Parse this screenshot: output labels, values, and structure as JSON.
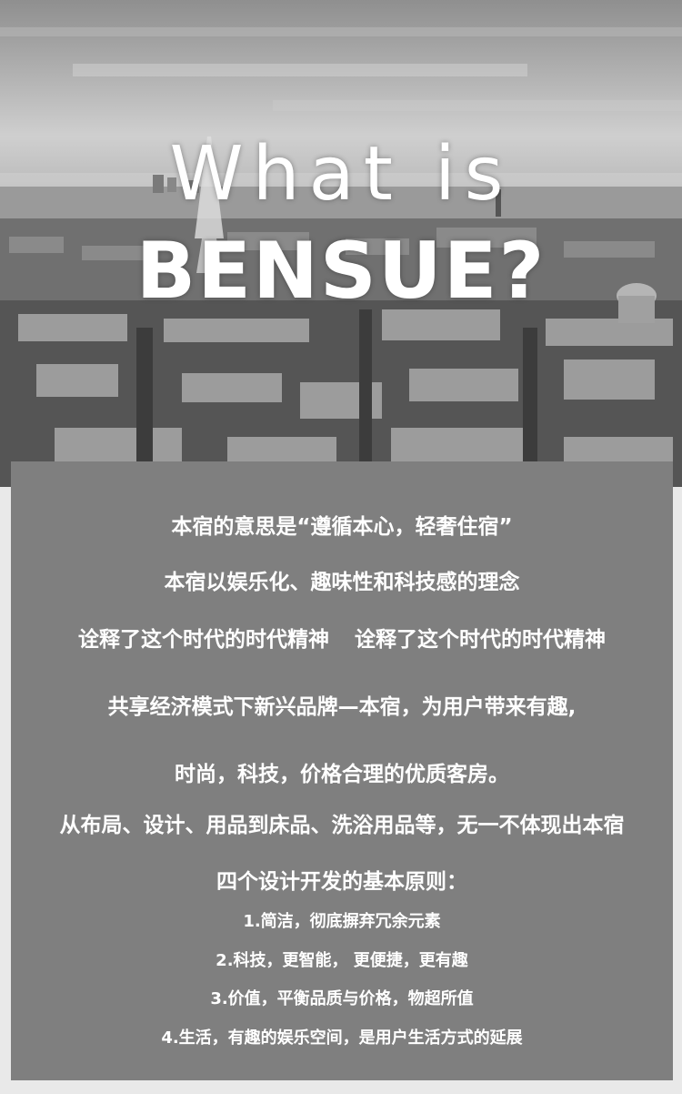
{
  "hero": {
    "title_line1": "What is",
    "title_line2": "BENSUE?"
  },
  "intro": {
    "line1": "本宿的意思是“遵循本心，轻奢住宿”",
    "line2": "本宿以娱乐化、趣味性和科技感的理念",
    "line3a": "诠释了这个时代的时代精神",
    "line3b": "诠释了这个时代的时代精神",
    "line4": "共享经济模式下新兴品牌—本宿，为用户带来有趣,",
    "line5": "时尚，科技，价格合理的优质客房。",
    "line6": "从布局、设计、用品到床品、洗浴用品等，无一不体现出本宿",
    "line7": "四个设计开发的基本原则："
  },
  "principles": [
    "1.简洁，彻底摒弃冗余元素",
    "2.科技，更智能， 更便捷，更有趣",
    "3.价值，平衡品质与价格，物超所值",
    "4.生活，有趣的娱乐空间，是用户生活方式的延展"
  ],
  "colors": {
    "panel": "#7f7f7f",
    "text": "#ffffff",
    "page_background": "#e9e9e9"
  }
}
